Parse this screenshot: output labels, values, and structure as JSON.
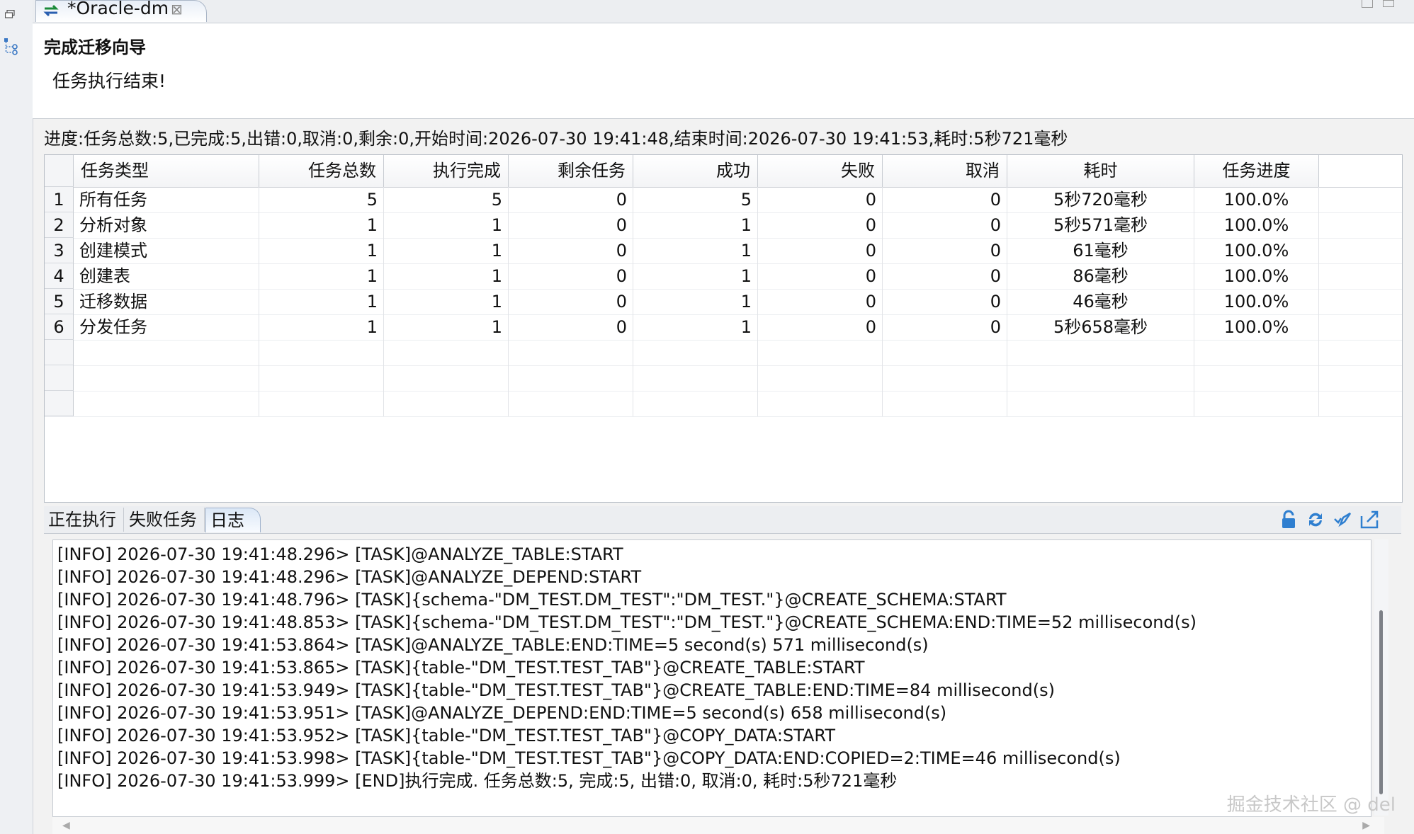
{
  "editor_tab": {
    "title": "*Oracle-dm",
    "close": "⊠"
  },
  "header": {
    "title": "完成迁移向导",
    "message": "任务执行结束!"
  },
  "progress": "进度:任务总数:5,已完成:5,出错:0,取消:0,剩余:0,开始时间:2026-07-30 19:41:48,结束时间:2026-07-30 19:41:53,耗时:5秒721毫秒",
  "table": {
    "columns": [
      "任务类型",
      "任务总数",
      "执行完成",
      "剩余任务",
      "成功",
      "失败",
      "取消",
      "耗时",
      "任务进度"
    ],
    "rows": [
      [
        "1",
        "所有任务",
        "5",
        "5",
        "0",
        "5",
        "0",
        "0",
        "5秒720毫秒",
        "100.0%"
      ],
      [
        "2",
        "分析对象",
        "1",
        "1",
        "0",
        "1",
        "0",
        "0",
        "5秒571毫秒",
        "100.0%"
      ],
      [
        "3",
        "创建模式",
        "1",
        "1",
        "0",
        "1",
        "0",
        "0",
        "61毫秒",
        "100.0%"
      ],
      [
        "4",
        "创建表",
        "1",
        "1",
        "0",
        "1",
        "0",
        "0",
        "86毫秒",
        "100.0%"
      ],
      [
        "5",
        "迁移数据",
        "1",
        "1",
        "0",
        "1",
        "0",
        "0",
        "46毫秒",
        "100.0%"
      ],
      [
        "6",
        "分发任务",
        "1",
        "1",
        "0",
        "1",
        "0",
        "0",
        "5秒658毫秒",
        "100.0%"
      ]
    ]
  },
  "bottom_tabs": [
    "正在执行",
    "失败任务",
    "日志"
  ],
  "active_tab": "日志",
  "log_lines": [
    "[INFO] 2026-07-30 19:41:48.296> [TASK]@ANALYZE_TABLE:START",
    "[INFO] 2026-07-30 19:41:48.296> [TASK]@ANALYZE_DEPEND:START",
    "[INFO] 2026-07-30 19:41:48.796> [TASK]{schema-\"DM_TEST.DM_TEST\":\"DM_TEST.\"}@CREATE_SCHEMA:START",
    "[INFO] 2026-07-30 19:41:48.853> [TASK]{schema-\"DM_TEST.DM_TEST\":\"DM_TEST.\"}@CREATE_SCHEMA:END:TIME=52 millisecond(s)",
    "[INFO] 2026-07-30 19:41:53.864> [TASK]@ANALYZE_TABLE:END:TIME=5 second(s) 571 millisecond(s)",
    "[INFO] 2026-07-30 19:41:53.865> [TASK]{table-\"DM_TEST.TEST_TAB\"}@CREATE_TABLE:START",
    "[INFO] 2026-07-30 19:41:53.949> [TASK]{table-\"DM_TEST.TEST_TAB\"}@CREATE_TABLE:END:TIME=84 millisecond(s)",
    "[INFO] 2026-07-30 19:41:53.951> [TASK]@ANALYZE_DEPEND:END:TIME=5 second(s) 658 millisecond(s)",
    "[INFO] 2026-07-30 19:41:53.952> [TASK]{table-\"DM_TEST.TEST_TAB\"}@COPY_DATA:START",
    "[INFO] 2026-07-30 19:41:53.998> [TASK]{table-\"DM_TEST.TEST_TAB\"}@COPY_DATA:END:COPIED=2:TIME=46 millisecond(s)",
    "[INFO] 2026-07-30 19:41:53.999> [END]执行完成. 任务总数:5, 完成:5, 出错:0, 取消:0, 耗时:5秒721毫秒"
  ],
  "watermark": "掘金技术社区 @ del",
  "scroll_arrows": {
    "left": "◀",
    "right": "▶"
  },
  "icons": [
    "restore-icon",
    "tree-icon",
    "swap-icon",
    "lock-icon",
    "refresh-icon",
    "clear-icon",
    "export-icon"
  ]
}
